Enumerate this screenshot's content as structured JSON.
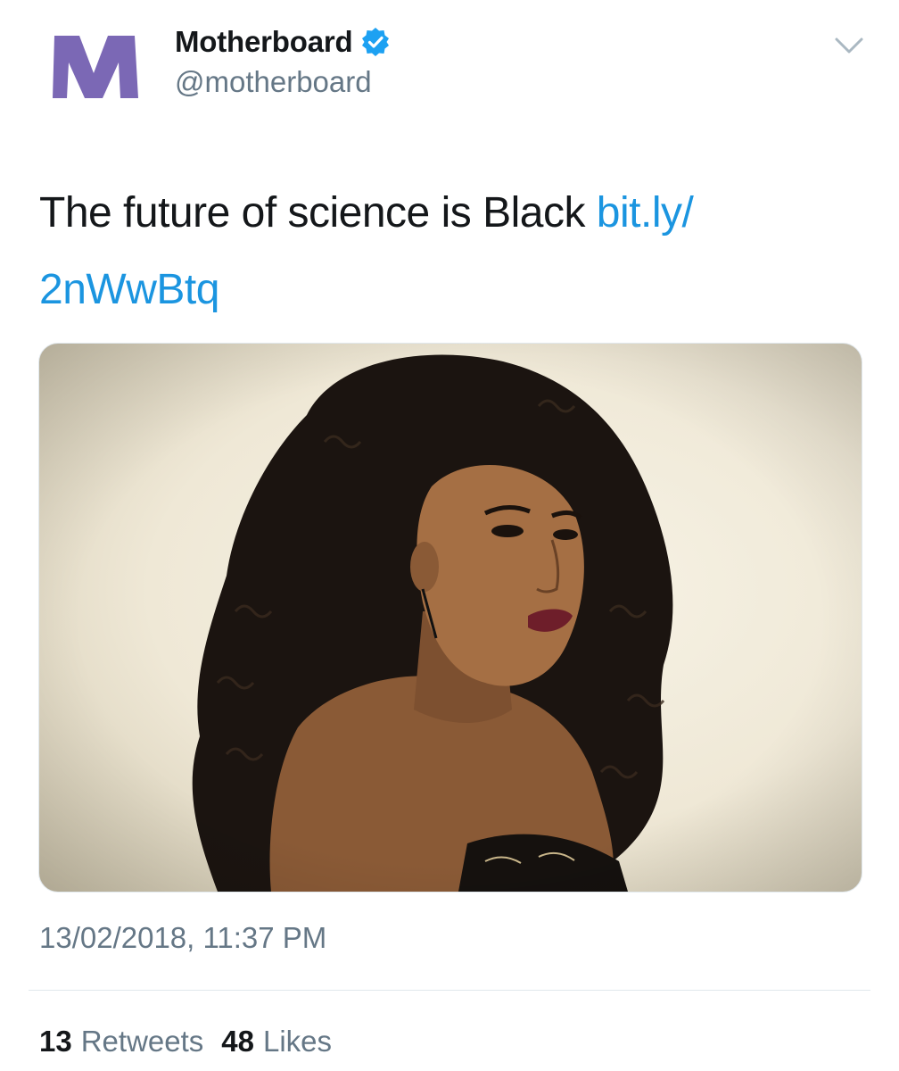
{
  "author": {
    "display_name": "Motherboard",
    "handle": "@motherboard",
    "verified": true,
    "logo_letter": "M",
    "logo_color": "#7b68b5"
  },
  "tweet": {
    "text": "The future of science is Black",
    "link_part1": "bit.ly/",
    "link_part2": "2nWwBtq",
    "link_color": "#1b95e0"
  },
  "media": {
    "type": "photo",
    "icon": "portrait-photo"
  },
  "timestamp": "13/02/2018, 11:37 PM",
  "stats": {
    "retweets_count": "13",
    "retweets_label": "Retweets",
    "likes_count": "48",
    "likes_label": "Likes"
  },
  "icons": {
    "verified": "verified-badge-icon",
    "menu": "chevron-down-icon"
  }
}
